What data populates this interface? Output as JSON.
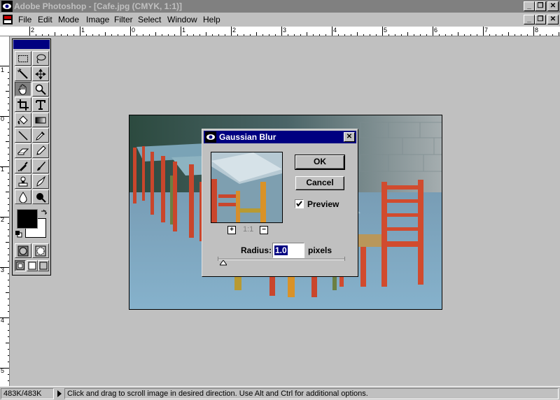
{
  "window": {
    "title": "Adobe Photoshop - [Cafe.jpg  (CMYK, 1:1)]",
    "buttons": {
      "minimize": "_",
      "restore": "❐",
      "close": "✕"
    }
  },
  "menu": {
    "items": [
      {
        "label": "File"
      },
      {
        "label": "Edit"
      },
      {
        "label": "Mode"
      },
      {
        "label": "Image"
      },
      {
        "label": "Filter"
      },
      {
        "label": "Select"
      },
      {
        "label": "Window"
      },
      {
        "label": "Help"
      }
    ]
  },
  "rulers": {
    "top": [
      "2",
      "1",
      "0",
      "1",
      "2",
      "3",
      "4",
      "5",
      "6",
      "7",
      "8"
    ],
    "left": [
      "1",
      "0",
      "1",
      "2",
      "3",
      "4",
      "5"
    ]
  },
  "toolbox": {
    "tools": [
      {
        "name": "marquee-tool",
        "icon": "marquee-icon"
      },
      {
        "name": "lasso-tool",
        "icon": "lasso-icon"
      },
      {
        "name": "magic-wand-tool",
        "icon": "magic-wand-icon"
      },
      {
        "name": "move-tool",
        "icon": "move-icon"
      },
      {
        "name": "hand-tool",
        "icon": "hand-icon",
        "active": true
      },
      {
        "name": "zoom-tool",
        "icon": "magnifier-icon"
      },
      {
        "name": "crop-tool",
        "icon": "crop-icon"
      },
      {
        "name": "type-tool",
        "icon": "type-icon"
      },
      {
        "name": "paint-bucket-tool",
        "icon": "paint-bucket-icon"
      },
      {
        "name": "gradient-tool",
        "icon": "gradient-icon"
      },
      {
        "name": "line-tool",
        "icon": "line-icon"
      },
      {
        "name": "eyedropper-tool",
        "icon": "eyedropper-icon"
      },
      {
        "name": "eraser-tool",
        "icon": "eraser-icon"
      },
      {
        "name": "pencil-tool",
        "icon": "pencil-icon"
      },
      {
        "name": "airbrush-tool",
        "icon": "airbrush-icon"
      },
      {
        "name": "paintbrush-tool",
        "icon": "paintbrush-icon"
      },
      {
        "name": "rubber-stamp-tool",
        "icon": "stamp-icon"
      },
      {
        "name": "smudge-tool",
        "icon": "smudge-icon"
      },
      {
        "name": "blur-tool",
        "icon": "drop-icon"
      },
      {
        "name": "burn-tool",
        "icon": "burn-icon"
      }
    ],
    "foreground_color": "#000000",
    "background_color": "#ffffff"
  },
  "dialog": {
    "title": "Gaussian Blur",
    "ok_label": "OK",
    "cancel_label": "Cancel",
    "preview_label": "Preview",
    "preview_checked": true,
    "zoom_plus": "+",
    "zoom_level": "1:1",
    "zoom_minus": "−",
    "radius_label": "Radius:",
    "radius_value": "1.0",
    "radius_unit": "pixels"
  },
  "statusbar": {
    "doc_size": "483K/483K",
    "message": "Click and drag to scroll image in desired direction.  Use Alt and Ctrl for additional options."
  },
  "colors": {
    "titlebar_inactive": "#808080",
    "dialog_title": "#000080",
    "face": "#c0c0c0"
  }
}
